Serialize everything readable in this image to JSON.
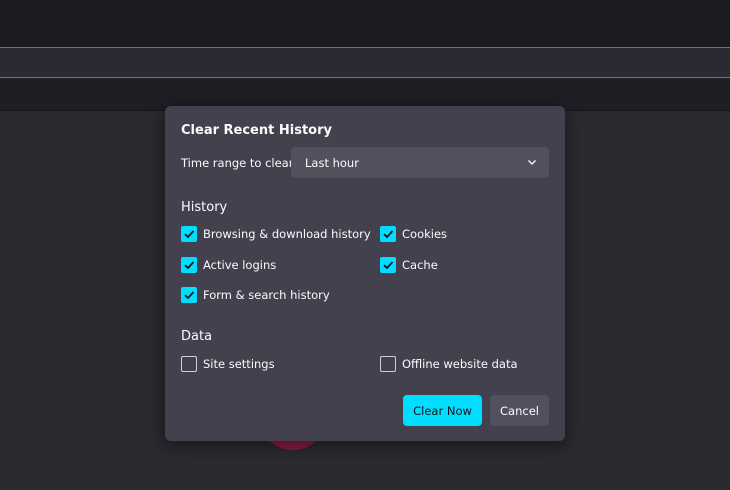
{
  "dialog": {
    "title": "Clear Recent History",
    "time_range_label": "Time range to clear:",
    "time_range_value": "Last hour",
    "history_heading": "History",
    "data_heading": "Data",
    "history_items": [
      {
        "label": "Browsing & download history",
        "checked": true
      },
      {
        "label": "Cookies",
        "checked": true
      },
      {
        "label": "Active logins",
        "checked": true
      },
      {
        "label": "Cache",
        "checked": true
      },
      {
        "label": "Form & search history",
        "checked": true
      }
    ],
    "data_items": [
      {
        "label": "Site settings",
        "checked": false
      },
      {
        "label": "Offline website data",
        "checked": false
      }
    ],
    "clear_now_label": "Clear Now",
    "cancel_label": "Cancel"
  },
  "colors": {
    "accent": "#00ddff",
    "dialog_bg": "#42414d",
    "page_bg": "#2a2a2f"
  },
  "icons": {
    "select_arrow": "chevron-down-icon",
    "check": "checkmark-icon"
  }
}
